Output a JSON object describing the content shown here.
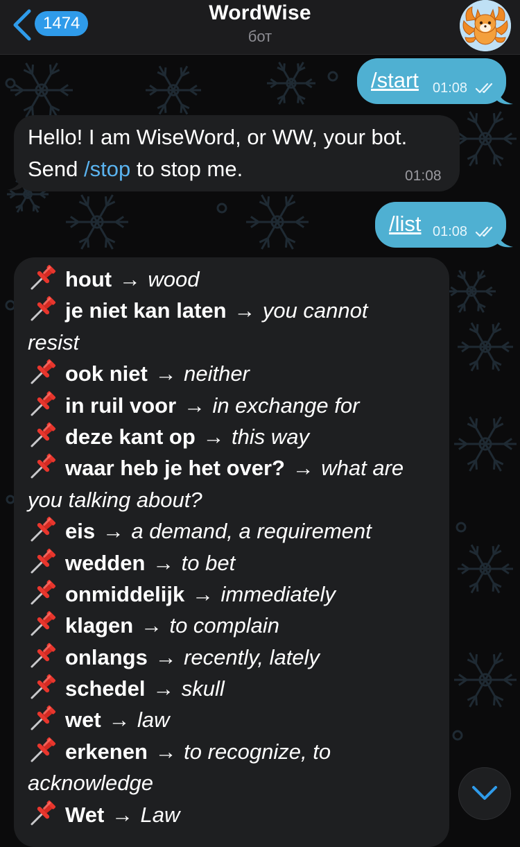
{
  "header": {
    "unread_count": "1474",
    "title": "WordWise",
    "subtitle": "бот"
  },
  "messages": {
    "start": {
      "command": "/start",
      "time": "01:08"
    },
    "greeting": {
      "line1": "Hello! I am WiseWord, or WW, your bot.",
      "line2_before": "Send ",
      "line2_link": "/stop",
      "line2_after": " to stop me.",
      "time": "01:08"
    },
    "list": {
      "command": "/list",
      "time": "01:08"
    }
  },
  "word_list": {
    "arrow": "→",
    "rows": [
      {
        "word": "hout",
        "trans": "wood"
      },
      {
        "word": "je niet kan laten",
        "trans": "you cannot"
      },
      {
        "cont": "resist"
      },
      {
        "word": "ook niet",
        "trans": "neither"
      },
      {
        "word": "in ruil voor",
        "trans": "in exchange for"
      },
      {
        "word": "deze kant op",
        "trans": "this way"
      },
      {
        "word": "waar heb je het over?",
        "trans": "what are"
      },
      {
        "cont": "you talking about?"
      },
      {
        "word": "eis",
        "trans": "a demand, a requirement"
      },
      {
        "word": "wedden",
        "trans": "to bet"
      },
      {
        "word": "onmiddelijk",
        "trans": "immediately"
      },
      {
        "word": "klagen",
        "trans": "to complain"
      },
      {
        "word": "onlangs",
        "trans": "recently, lately"
      },
      {
        "word": "schedel",
        "trans": "skull"
      },
      {
        "word": "wet",
        "trans": "law"
      },
      {
        "word": "erkenen",
        "trans": "to recognize, to"
      },
      {
        "cont": "acknowledge"
      },
      {
        "word": "Wet",
        "trans": "Law"
      }
    ]
  },
  "icons": {
    "back": "chevron-left-icon",
    "read_receipt": "double-check-icon",
    "pin": "pushpin-icon",
    "scroll_down": "chevron-down-icon"
  },
  "colors": {
    "accent": "#2f9bea",
    "outgoing_bubble": "#4fb0d2",
    "incoming_bubble": "#1e1f21",
    "link": "#5ab3ef"
  }
}
